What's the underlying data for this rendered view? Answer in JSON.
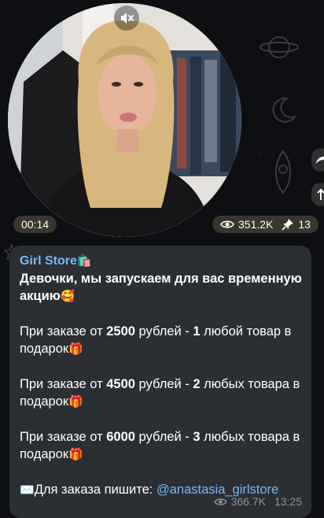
{
  "video_note": {
    "duration": "00:14",
    "views": "351.2K",
    "reactions": "13"
  },
  "message": {
    "sender": "Girl Store",
    "sender_emoji": "🛍️",
    "headline": "Девочки, мы запускаем для вас временную акцию",
    "headline_emoji": "🥰",
    "offers": [
      {
        "prefix": "При заказе от ",
        "amount": "2500",
        "mid": " рублей - ",
        "count": "1",
        "suffix": " любой товар в подарок",
        "emoji": "🎁"
      },
      {
        "prefix": "При заказе от ",
        "amount": "4500",
        "mid": " рублей - ",
        "count": "2",
        "suffix": " любых товара в подарок",
        "emoji": "🎁"
      },
      {
        "prefix": "При заказе от ",
        "amount": "6000",
        "mid": " рублей - ",
        "count": "3",
        "suffix": " любых товара в подарок",
        "emoji": "🎁"
      }
    ],
    "contact_emoji": "✉️",
    "contact_text": "Для заказа пишите: ",
    "contact_handle": "@anastasia_girlstore",
    "views": "366.7K",
    "time": "13:25"
  },
  "icons": [
    "mute-icon",
    "eye-icon",
    "pin-icon",
    "gift-icon",
    "envelope-icon",
    "shopping-bags-icon",
    "smiling-face-hearts-icon"
  ]
}
